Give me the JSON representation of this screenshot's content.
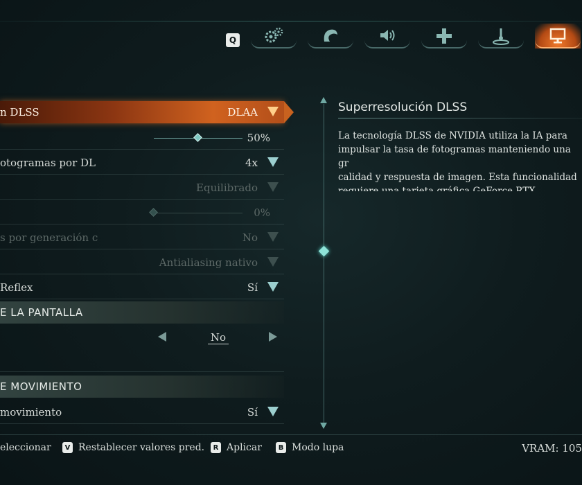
{
  "tabs": {
    "q_key": "Q",
    "items": [
      {
        "icon": "gears-icon",
        "active": false
      },
      {
        "icon": "character-icon",
        "active": false
      },
      {
        "icon": "speaker-icon",
        "active": false
      },
      {
        "icon": "dpad-icon",
        "active": false
      },
      {
        "icon": "joystick-icon",
        "active": false
      },
      {
        "icon": "monitor-icon",
        "active": true
      }
    ]
  },
  "settings": {
    "row1": {
      "label": "n DLSS",
      "value": "DLAA"
    },
    "row2": {
      "value": "50%",
      "slider_level": 0.5
    },
    "row3": {
      "label": "otogramas por DL",
      "value": "4x"
    },
    "row4": {
      "value": "Equilibrado"
    },
    "row5": {
      "value": "0%",
      "slider_level": 0
    },
    "row6": {
      "label": "s por generación c",
      "value": "No"
    },
    "row7": {
      "value": "Antialiasing nativo"
    },
    "row8": {
      "label": "Reflex",
      "value": "Sí"
    },
    "section1": "E LA PANTALLA",
    "row9": {
      "value": "No"
    },
    "section2": "E MOVIMIENTO",
    "row10": {
      "label": "movimiento",
      "value": "Sí"
    }
  },
  "description": {
    "title": "Superresolución DLSS",
    "body": "La tecnología DLSS de NVIDIA utiliza la IA para\nimpulsar la tasa de fotogramas manteniendo una gr\ncalidad y respuesta de imagen. Esta funcionalidad\nrequiere una tarjeta gráfica GeForce RTX."
  },
  "footer": {
    "select": "eleccionar",
    "reset_key": "V",
    "reset": "Restablecer valores pred.",
    "apply_key": "R",
    "apply": "Aplicar",
    "magnifier_key": "B",
    "magnifier": "Modo lupa",
    "vram": "VRAM: 105"
  },
  "colors": {
    "accent": "#d0621f",
    "teal": "#7fc9c3"
  }
}
